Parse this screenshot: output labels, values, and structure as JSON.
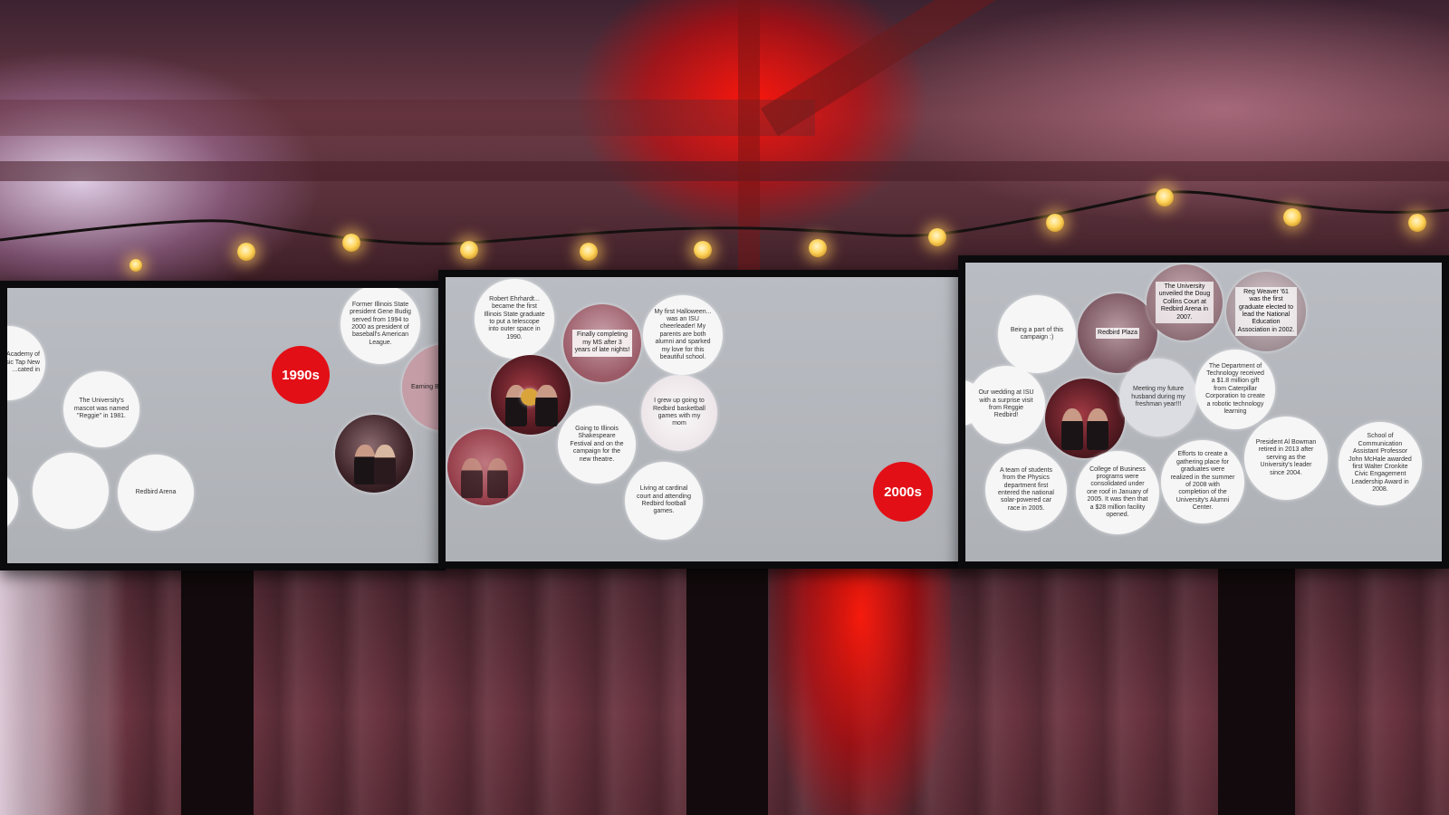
{
  "screens": {
    "left": {
      "decade_label": "1990s",
      "bubbles": {
        "b1": "Former Illinois State president Gene Budig served from 1994 to 2000 as president of baseball's American League.",
        "b2": "The University's mascot was named \"Reggie\" in 1981.",
        "b3": "Earning BS, MS",
        "b4": "Redbird Arena",
        "b5": "gave \"N Academy of Music Tap New ...cated in",
        "b6": ""
      }
    },
    "middle": {
      "decade_label": "2000s",
      "bubbles": {
        "m1": "Robert Ehrhardt... became the first Illinois State graduate to put a telescope into outer space in 1990.",
        "m2": "My first Halloween... was an ISU cheerleader! My parents are both alumni and sparked my love for this beautiful school.",
        "m3": "Finally completing my MS after 3 years of late nights!",
        "m4": "I grew up going to Redbird basketball games with my mom",
        "m5": "Going to Illinois Shakespeare Festival and on the campaign for the new theatre.",
        "m6": "Living at cardinal court and attending Redbird football games."
      }
    },
    "right": {
      "bubbles": {
        "r1": "Being a part of this campaign :)",
        "r2": "Redbird Plaza",
        "r3": "The University unveiled the Doug Collins Court at Redbird Arena in 2007.",
        "r4": "Reg Weaver '61 was the first graduate elected to lead the National Education Association in 2002.",
        "r5": "Our wedding at ISU with a surprise visit from Reggie Redbird!",
        "r6": "Meeting my future husband during my freshman year!!!",
        "r7": "The Department of Technology received a $1.8 million gift from Caterpillar Corporation to create a robotic technology learning",
        "r8": "A team of students from the Physics department first entered the national solar-powered car race in 2005.",
        "r9": "College of Business programs were consolidated under one roof in January of 2005. It was then that a $28 million facility opened.",
        "r10": "Efforts to create a gathering place for graduates were realized in the summer of 2008 with completion of the University's Alumni Center.",
        "r11": "President Al Bowman retired in 2013 after serving as the University's leader since 2004.",
        "r12": "School of Communication Assistant Professor John McHale awarded first Walter Cronkite Civic Engagement Leadership Award in 2008."
      }
    }
  },
  "colors": {
    "decade_red": "#e30f16",
    "screen_bg": "#b5b8bd",
    "bubble_white": "#f6f6f6",
    "stage_red_light": "#ff1a0a"
  }
}
